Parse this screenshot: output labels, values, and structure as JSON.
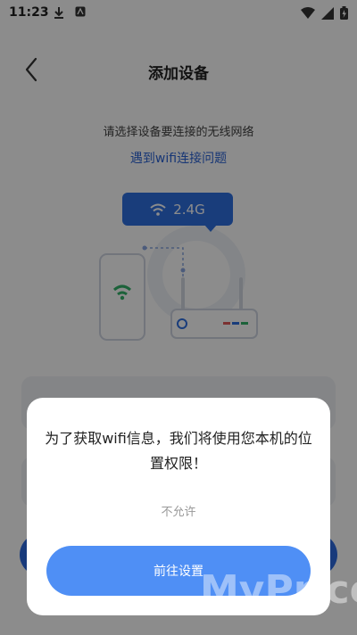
{
  "status": {
    "time": "11:23"
  },
  "nav": {
    "title": "添加设备"
  },
  "prompt": {
    "text": "请选择设备要连接的无线网络",
    "help_link": "遇到wifi连接问题"
  },
  "illustration": {
    "band_label": "2.4G"
  },
  "dialog": {
    "message": "为了获取wifi信息，我们将使用您本机的位置权限！",
    "deny_label": "不允许",
    "go_label": "前往设置"
  },
  "watermark": {
    "text": "MyPrice"
  },
  "colors": {
    "accent": "#2f6fe0",
    "dialog_button": "#4f8ff5",
    "link": "#2b63d6"
  }
}
